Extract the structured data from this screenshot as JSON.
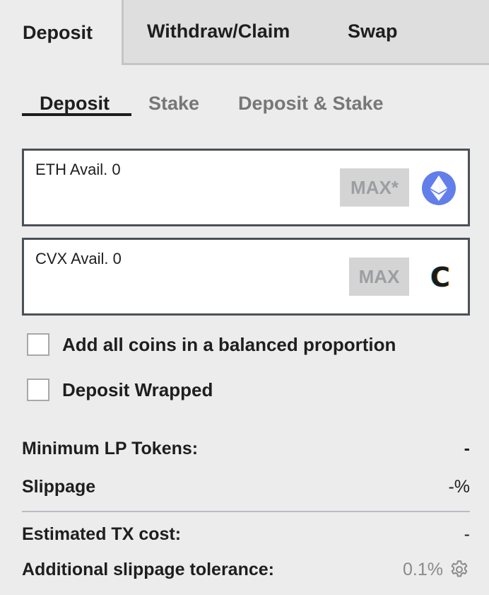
{
  "top_tabs": {
    "deposit": "Deposit",
    "withdraw_claim": "Withdraw/Claim",
    "swap": "Swap"
  },
  "sub_tabs": {
    "deposit": "Deposit",
    "stake": "Stake",
    "deposit_stake": "Deposit & Stake"
  },
  "coins": [
    {
      "label": "ETH Avail. 0",
      "max_label": "MAX*",
      "icon": "ethereum-icon"
    },
    {
      "label": "CVX Avail. 0",
      "max_label": "MAX",
      "icon": "cvx-icon",
      "icon_glyph": "C"
    }
  ],
  "options": {
    "balanced": "Add all coins in a balanced proportion",
    "wrapped": "Deposit Wrapped"
  },
  "info": {
    "min_lp_label": "Minimum LP Tokens:",
    "min_lp_value": "-",
    "slippage_label": "Slippage",
    "slippage_value": "-%",
    "tx_cost_label": "Estimated TX cost:",
    "tx_cost_value": "-",
    "add_slippage_label": "Additional slippage tolerance:",
    "add_slippage_value": "0.1%"
  },
  "colors": {
    "background": "#ececec",
    "inactive_tab": "#dedede",
    "box_border": "#4c5157",
    "max_bg": "#d4d4d4",
    "max_text": "#9c9ea1",
    "eth_blue": "#627eea"
  }
}
